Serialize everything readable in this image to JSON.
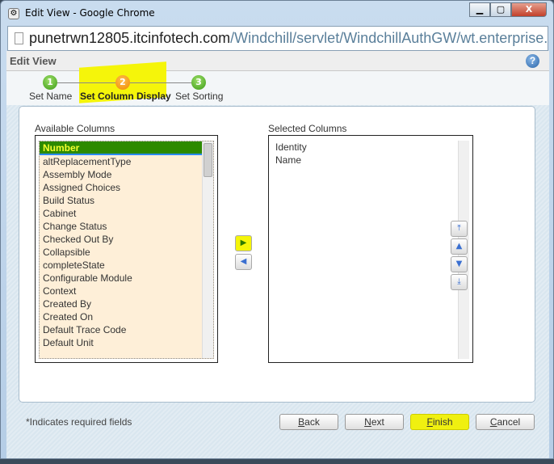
{
  "window": {
    "title": "Edit View - Google Chrome",
    "controls": [
      "minimize",
      "maximize",
      "close"
    ]
  },
  "address": {
    "host": "punetrwn12805.itcinfotech.com",
    "path": "/Windchill/servlet/WindchillAuthGW/wt.enterprise.URLProce"
  },
  "dialog": {
    "title": "Edit View",
    "help_icon": "help-icon"
  },
  "steps": [
    {
      "num": "1",
      "label": "Set Name",
      "state": "done"
    },
    {
      "num": "2",
      "label": "Set Column Display",
      "state": "current"
    },
    {
      "num": "3",
      "label": "Set Sorting",
      "state": "done"
    }
  ],
  "available": {
    "label": "Available Columns",
    "selected": "Number",
    "items": [
      "Number",
      "altReplacementType",
      "Assembly Mode",
      "Assigned Choices",
      "Build Status",
      "Cabinet",
      "Change Status",
      "Checked Out By",
      "Collapsible",
      "completeState",
      "Configurable Module",
      "Context",
      "Created By",
      "Created On",
      "Default Trace Code",
      "Default Unit"
    ]
  },
  "selected": {
    "label": "Selected Columns",
    "items": [
      "Identity",
      "Name"
    ]
  },
  "move": {
    "add": "▶",
    "remove": "◀"
  },
  "order": {
    "top": "move-top",
    "up": "move-up",
    "down": "move-down",
    "bottom": "move-bottom"
  },
  "footer": {
    "required_note": "*Indicates required fields",
    "back": {
      "k": "B",
      "rest": "ack"
    },
    "next": {
      "k": "N",
      "rest": "ext"
    },
    "finish": {
      "k": "F",
      "rest": "inish"
    },
    "cancel": {
      "k": "C",
      "rest": "ancel"
    }
  },
  "colors": {
    "highlight": "#f5f50a",
    "selection": "#2d8a00",
    "list_bg": "#feefd8"
  }
}
